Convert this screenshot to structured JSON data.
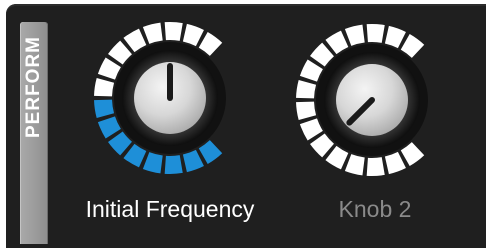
{
  "panel": {
    "tab_label": "PERFORM"
  },
  "knobs": [
    {
      "label": "Initial Frequency",
      "value": 0.5,
      "active": true,
      "label_color": "#ffffff",
      "lit_color": "#1e8fd8",
      "unlit_color": "#ffffff"
    },
    {
      "label": "Knob 2",
      "value": 0.0,
      "active": false,
      "label_color": "#8a8a8a",
      "lit_color": "#ffffff",
      "unlit_color": "#ffffff"
    }
  ]
}
